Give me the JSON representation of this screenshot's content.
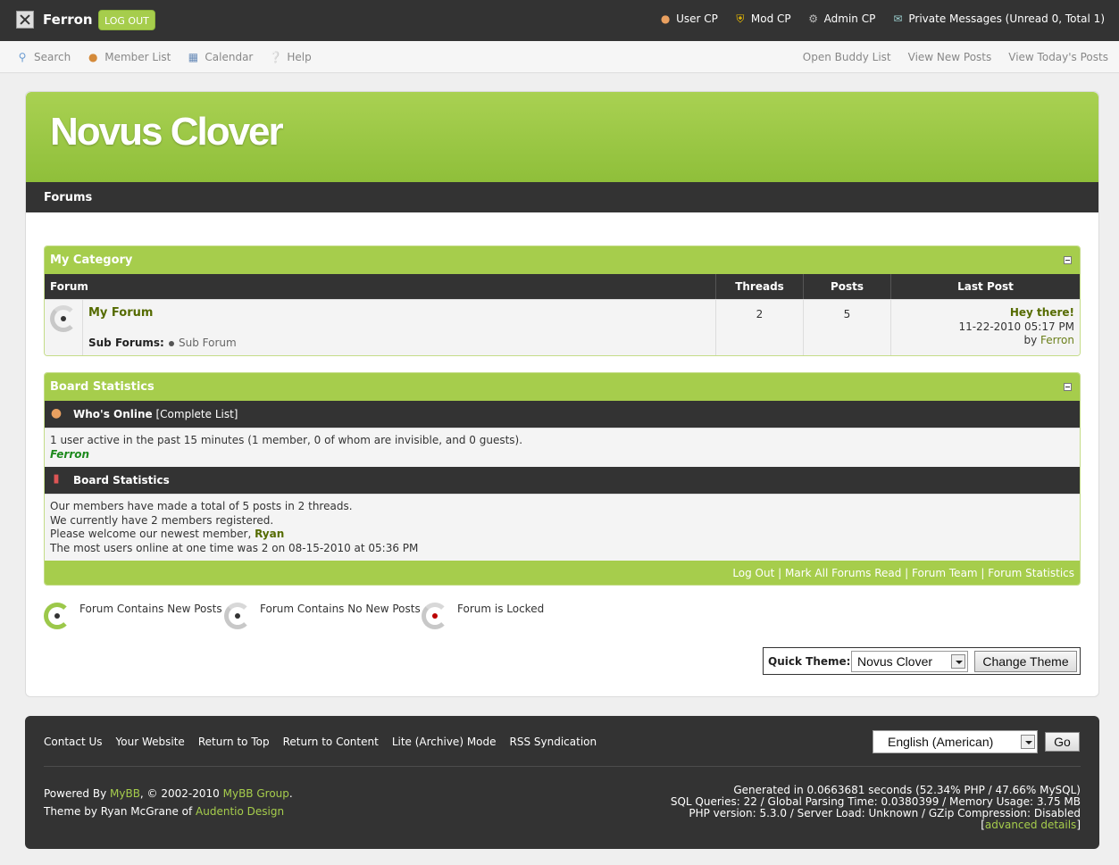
{
  "topbar": {
    "username": "Ferron",
    "logout_label": "LOG OUT",
    "links": [
      "User CP",
      "Mod CP",
      "Admin CP",
      "Private Messages (Unread 0, Total 1)"
    ]
  },
  "subbar": {
    "left": [
      "Search",
      "Member List",
      "Calendar",
      "Help"
    ],
    "right": [
      "Open Buddy List",
      "View New Posts",
      "View Today's Posts"
    ]
  },
  "header": {
    "site_title": "Novus Clover"
  },
  "navbar": {
    "label": "Forums"
  },
  "category": {
    "title": "My Category",
    "columns": {
      "forum": "Forum",
      "threads": "Threads",
      "posts": "Posts",
      "last_post": "Last Post"
    },
    "forum": {
      "name": "My Forum",
      "sub_forums_label": "Sub Forums:",
      "sub_forum": "Sub Forum",
      "threads": "2",
      "posts": "5",
      "last_post_title": "Hey there!",
      "last_post_date": "11-22-2010 05:17 PM",
      "last_post_by": "by",
      "last_post_user": "Ferron"
    }
  },
  "stats": {
    "title": "Board Statistics",
    "whos_online": "Who's Online",
    "complete_list": "[Complete List]",
    "online_text": "1 user active in the past 15 minutes (1 member, 0 of whom are invisible, and 0 guests).",
    "online_user": "Ferron",
    "board_stats_label": "Board Statistics",
    "line1": "Our members have made a total of 5 posts in 2 threads.",
    "line2": "We currently have 2 members registered.",
    "line3_prefix": "Please welcome our newest member,",
    "newest_member": "Ryan",
    "line4": "The most users online at one time was 2 on 08-15-2010 at 05:36 PM",
    "foot_links": [
      "Log Out",
      "Mark All Forums Read",
      "Forum Team",
      "Forum Statistics"
    ]
  },
  "legend": {
    "new": "Forum Contains New Posts",
    "none": "Forum Contains No New Posts",
    "locked": "Forum is Locked"
  },
  "quick_theme": {
    "label": "Quick Theme:",
    "selected": "Novus Clover",
    "button": "Change Theme"
  },
  "footer": {
    "links": [
      "Contact Us",
      "Your Website",
      "Return to Top",
      "Return to Content",
      "Lite (Archive) Mode",
      "RSS Syndication"
    ],
    "language": "English (American)",
    "go": "Go",
    "powered_prefix": "Powered By",
    "mybb": "MyBB",
    "copyright": ", © 2002-2010",
    "mybb_group": "MyBB Group",
    "theme_prefix": "Theme by Ryan McGrane of",
    "audentio": "Audentio Design",
    "debug_line1": "Generated in 0.0663681 seconds (52.34% PHP / 47.66% MySQL)",
    "debug_line2": "SQL Queries: 22 / Global Parsing Time: 0.0380399 / Memory Usage: 3.75 MB",
    "debug_line3": "PHP version: 5.3.0 / Server Load: Unknown / GZip Compression: Disabled",
    "advanced": "advanced details"
  },
  "colors": {
    "accent": "#a6cd4c",
    "dark": "#333333",
    "link": "#6b7f1a"
  }
}
